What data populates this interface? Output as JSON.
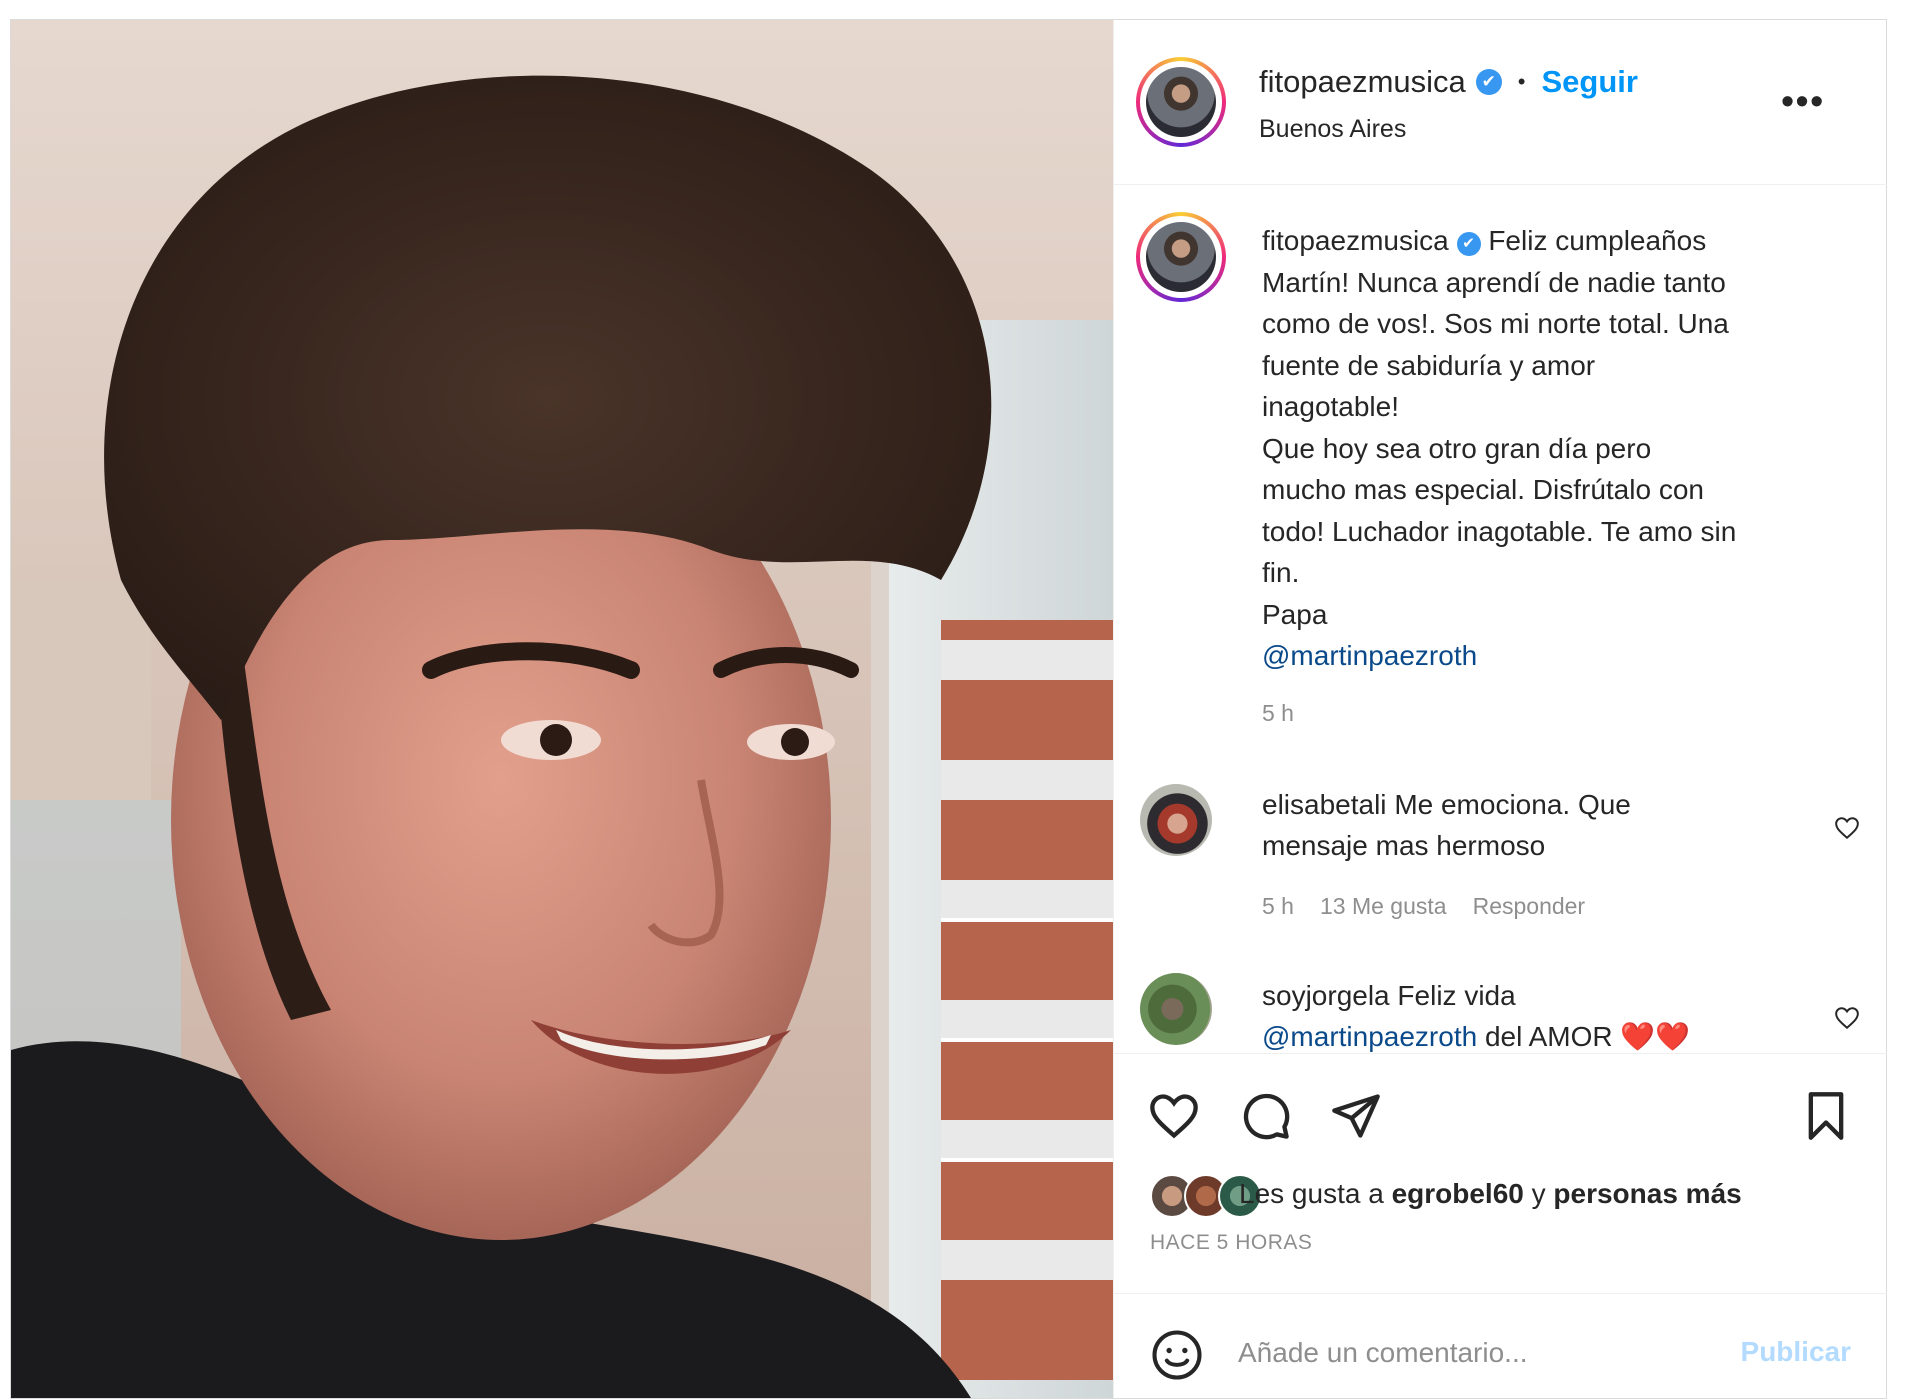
{
  "post": {
    "author": "fitopaezmusica",
    "verified_mark": "✔",
    "follow_label": "Seguir",
    "dot": "•",
    "location": "Buenos Aires",
    "more_label": "•••",
    "photo_icon": "portrait-photo"
  },
  "caption": {
    "author": "fitopaezmusica",
    "lines": [
      "Feliz cumpleaños",
      "Martín! Nunca aprendí de nadie tanto",
      "como de vos!. Sos mi norte total. Una",
      "fuente de sabiduría y amor",
      "inagotable!",
      "Que hoy sea otro gran día pero",
      "mucho mas especial. Disfrútalo con",
      "todo! Luchador inagotable. Te amo sin",
      "fin.",
      "Papa"
    ],
    "mention": "@martinpaezroth",
    "time": "5 h"
  },
  "comments": [
    {
      "user": "elisabetali",
      "text_1": "Me emociona. Que",
      "text_2": "mensaje mas hermoso",
      "time": "5 h",
      "likes": "13 Me gusta",
      "reply": "Responder"
    },
    {
      "user": "soyjorgela",
      "text_1": "Feliz vida",
      "mention": "@martinpaezroth",
      "text_2": "del AMOR",
      "hearts": "❤️❤️"
    }
  ],
  "actions": {
    "icons": [
      "heart-icon",
      "comment-icon",
      "share-icon",
      "bookmark-icon"
    ],
    "likes_prefix": "Les gusta a",
    "likes_user": "egrobel60",
    "likes_joiner": "y",
    "likes_suffix": "personas más",
    "time_ago": "HACE 5 HORAS"
  },
  "add_comment": {
    "placeholder": "Añade un comentario...",
    "publish_label": "Publicar"
  },
  "colors": {
    "accent_blue": "#0095f6",
    "publish_disabled": "#b3dbff",
    "meta_gray": "#8e8e8e"
  }
}
